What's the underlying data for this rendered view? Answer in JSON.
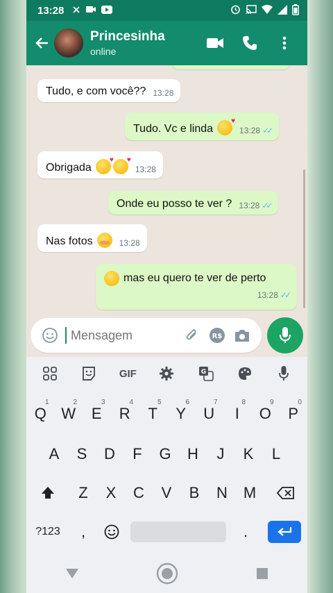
{
  "status_bar": {
    "time": "13:28"
  },
  "header": {
    "contact_name": "Princesinha",
    "contact_status": "online"
  },
  "messages": [
    {
      "direction": "in",
      "text": "Tudo, e com você??",
      "time": "13:28"
    },
    {
      "direction": "out",
      "text": "Tudo. Vc e linda",
      "time": "13:28",
      "emoji": "smiling-face-with-hearts"
    },
    {
      "direction": "in",
      "text": "Obrigada",
      "time": "13:28",
      "emoji": "smiling-face-with-hearts-x2"
    },
    {
      "direction": "out",
      "text": "Onde eu posso te ver ?",
      "time": "13:28"
    },
    {
      "direction": "in",
      "text": "Nas fotos",
      "time": "13:28",
      "emoji": "face-with-hand-over-mouth"
    },
    {
      "direction": "out",
      "text": "mas eu quero te ver de perto",
      "time": "13:28",
      "emoji_prefix": "slightly-smiling-face"
    }
  ],
  "composer": {
    "placeholder": "Mensagem"
  },
  "keyboard": {
    "toolbar": {
      "gif_label": "GIF"
    },
    "row1": [
      {
        "key": "Q",
        "hint": "1"
      },
      {
        "key": "W",
        "hint": "2"
      },
      {
        "key": "E",
        "hint": "3"
      },
      {
        "key": "R",
        "hint": "4"
      },
      {
        "key": "T",
        "hint": "5"
      },
      {
        "key": "Y",
        "hint": "6"
      },
      {
        "key": "U",
        "hint": "7"
      },
      {
        "key": "I",
        "hint": "8"
      },
      {
        "key": "O",
        "hint": "9"
      },
      {
        "key": "P",
        "hint": "0"
      }
    ],
    "row2": [
      "A",
      "S",
      "D",
      "F",
      "G",
      "H",
      "J",
      "K",
      "L"
    ],
    "row3": [
      "Z",
      "X",
      "C",
      "V",
      "B",
      "N",
      "M"
    ],
    "symbols_label": "?123",
    "comma": ",",
    "period": "."
  },
  "colors": {
    "header": "#128c6c",
    "outgoing_bubble": "#dcf8c6",
    "incoming_bubble": "#ffffff",
    "mic_button": "#1da464",
    "enter_key": "#1a73e8",
    "read_ticks": "#53bdeb"
  },
  "icons": {
    "status_bar": [
      "alarm-icon",
      "cast-icon",
      "wifi-icon",
      "signal-icon",
      "battery-icon"
    ],
    "header": [
      "back-arrow-icon",
      "video-call-icon",
      "phone-icon",
      "more-vert-icon"
    ],
    "composer": [
      "emoji-icon",
      "attach-icon",
      "payment-icon",
      "camera-icon",
      "mic-icon"
    ]
  }
}
